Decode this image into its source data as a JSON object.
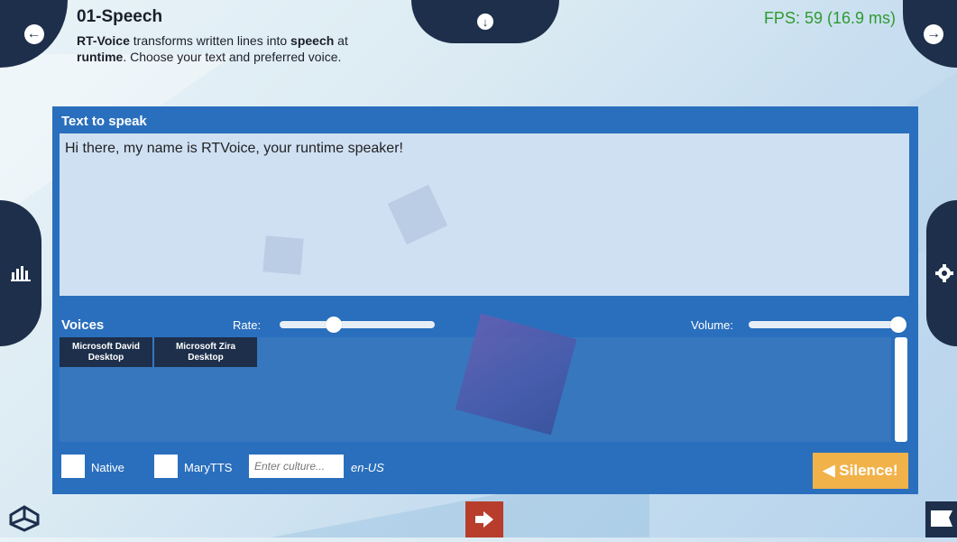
{
  "header": {
    "title": "01-Speech",
    "desc_bold1": "RT-Voice",
    "desc_text1": " transforms written lines into ",
    "desc_bold2": "speech",
    "desc_text2": " at",
    "desc_bold3": "runtime",
    "desc_text3": ". Choose your text and preferred voice."
  },
  "fps": "FPS: 59 (16.9 ms)",
  "text_panel": {
    "label": "Text to speak",
    "text": "Hi there, my name is RTVoice, your runtime speaker!"
  },
  "voices": {
    "label": "Voices",
    "rate_label": "Rate:",
    "rate_value": 0.35,
    "volume_label": "Volume:",
    "volume_value": 1.0,
    "items": [
      {
        "name": "Microsoft David\nDesktop"
      },
      {
        "name": "Microsoft Zira\nDesktop"
      }
    ]
  },
  "options": {
    "native_label": "Native",
    "marytts_label": "MaryTTS",
    "culture_placeholder": "Enter culture...",
    "culture_value": "en-US"
  },
  "silence_label": "◀ Silence!",
  "colors": {
    "panel": "#2a6fbd",
    "nav": "#1d2f4b",
    "fps": "#2f9a2f",
    "silence": "#f1b24a",
    "exit": "#b83d2c"
  }
}
